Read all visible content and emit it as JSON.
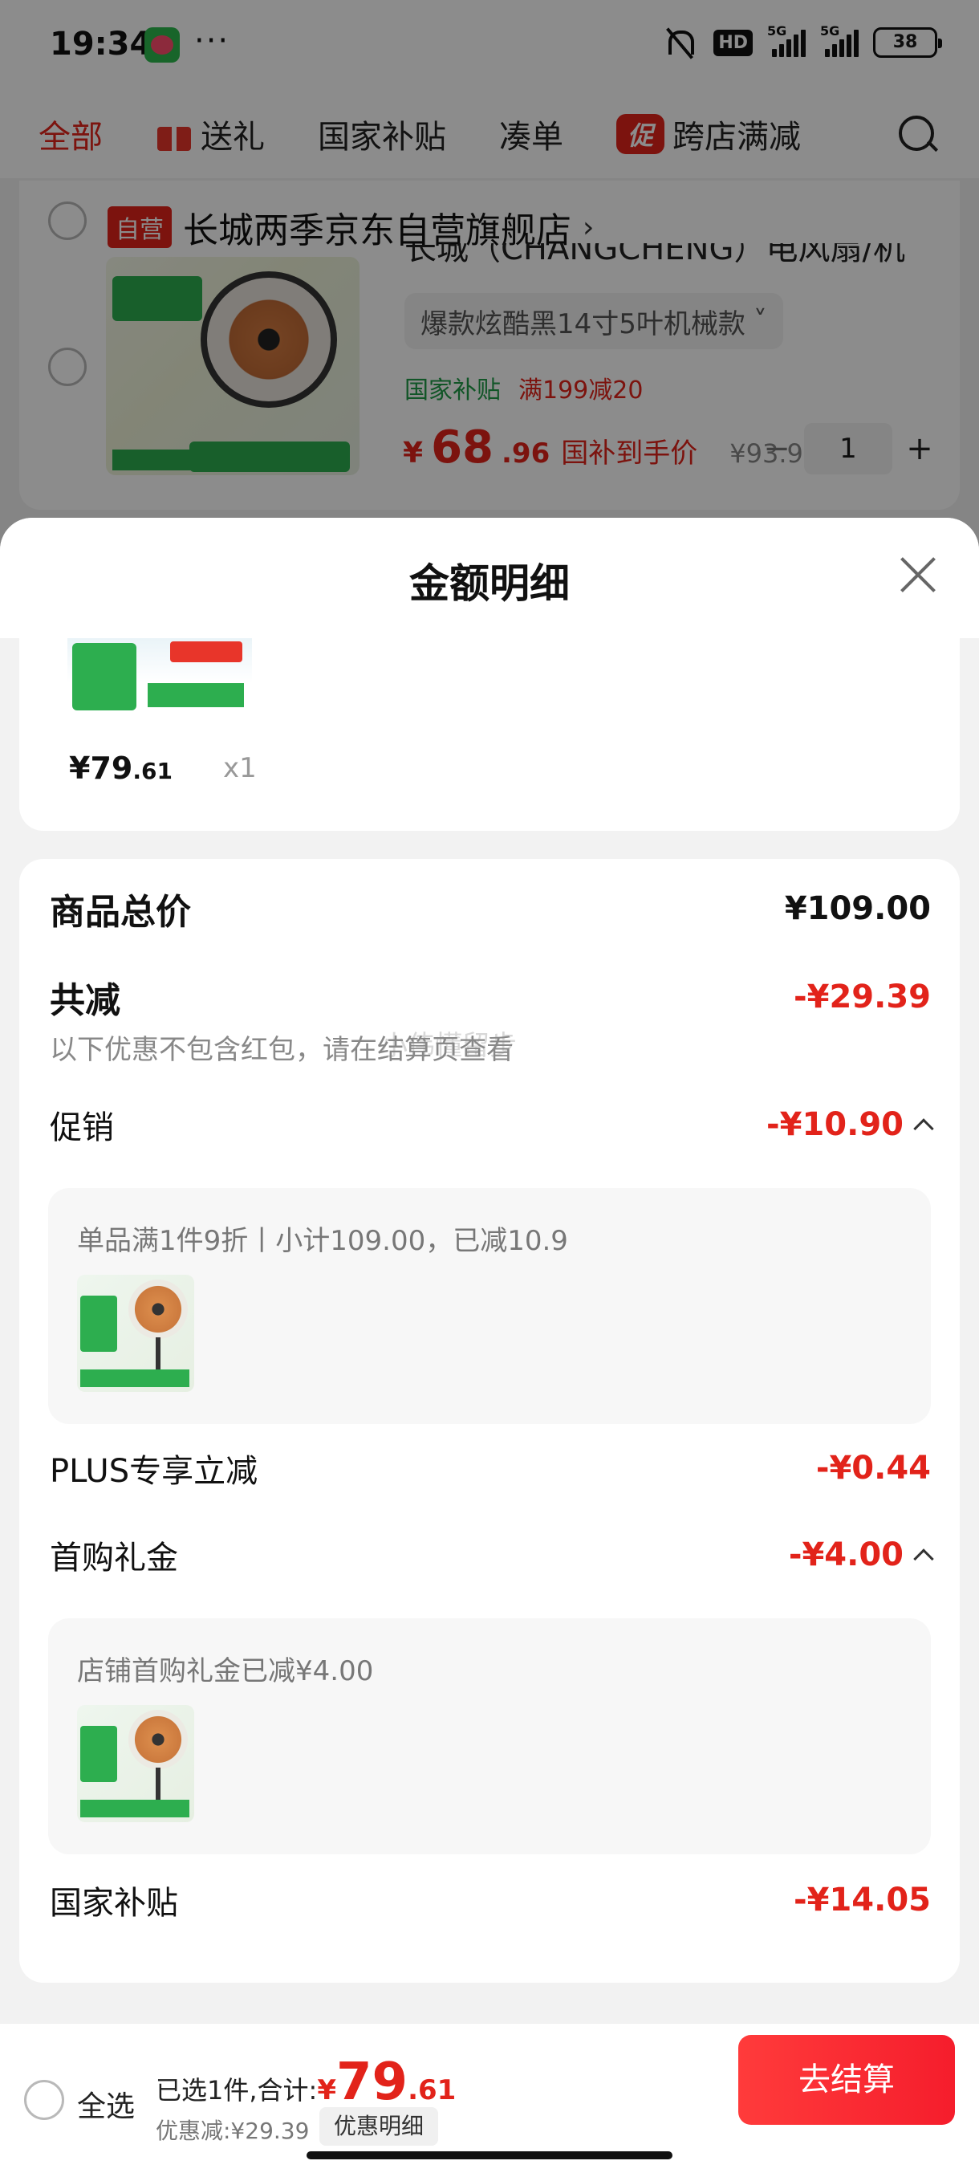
{
  "status_bar": {
    "time": "19:34",
    "dots": "···",
    "network_hd": "HD",
    "network_tag_1": "5G",
    "network_tag_2": "5G",
    "battery": "38"
  },
  "top_nav": {
    "items": [
      {
        "label": "全部",
        "active": true
      },
      {
        "label": "送礼",
        "icon": "gift-icon"
      },
      {
        "label": "国家补贴"
      },
      {
        "label": "凑单"
      },
      {
        "label": "跨店满减",
        "icon": "promo-badge"
      }
    ],
    "promo_badge_text": "促"
  },
  "store": {
    "self_tag": "自营",
    "name": "长城两季京东自营旗舰店",
    "chevron": "›",
    "product": {
      "title": "长城（CHANGCHENG）电风扇/机",
      "sku": "爆款炫酷黑14寸5叶机械款",
      "sku_chevron": "˅",
      "tag_subsidy": "国家补贴",
      "tag_discount": "满199减20",
      "price_currency": "¥",
      "price_int": "68",
      "price_dec": ".96",
      "price_note": "国补到手价",
      "price_orig": "¥93.9",
      "qty_minus": "−",
      "qty": "1",
      "qty_plus": "+"
    }
  },
  "sheet": {
    "title": "金额明细",
    "item": {
      "price_int": "¥79",
      "price_dec": ".61",
      "qty": "x1"
    },
    "total_label": "商品总价",
    "total_value": "¥109.00",
    "discount_label": "共减",
    "discount_value": "-¥29.39",
    "discount_note": "以下优惠不包含红包，请在结算页查看",
    "watermark": "小伟懂留步",
    "promo_label": "促销",
    "promo_value": "-¥10.90",
    "promo_detail": "单品满1件9折丨小计109.00，已减10.9",
    "plus_label": "PLUS专享立减",
    "plus_value": "-¥0.44",
    "first_label": "首购礼金",
    "first_value": "-¥4.00",
    "first_detail": "店铺首购礼金已减¥4.00",
    "subsidy_label": "国家补贴",
    "subsidy_value": "-¥14.05"
  },
  "bottom_bar": {
    "select_all": "全选",
    "selected_text": "已选1件,合计:",
    "currency": "¥",
    "total_int": "79",
    "total_dec": ".61",
    "saved": "优惠减:¥29.39",
    "detail_button": "优惠明细",
    "checkout": "去结算"
  },
  "colors": {
    "accent_red": "#e2231a",
    "subsidy_green": "#1f9b47",
    "sheet_bg": "#f2f2f2"
  }
}
